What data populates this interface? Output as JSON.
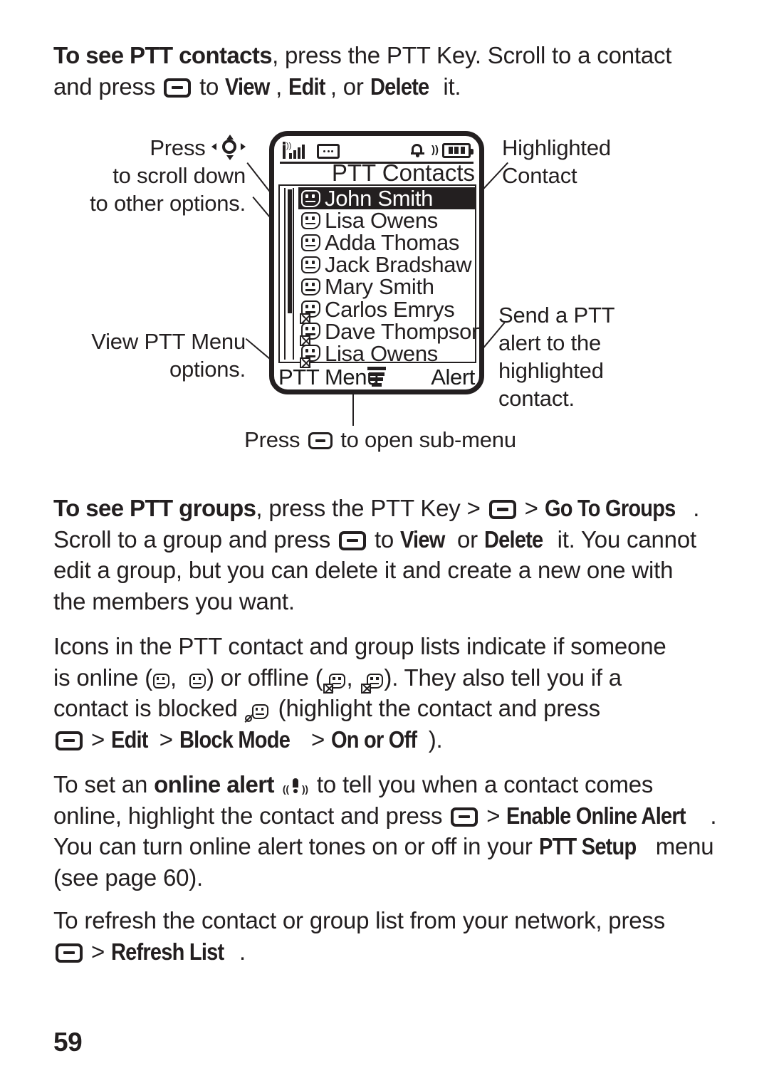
{
  "document": {
    "page_number": "59"
  },
  "sections": {
    "ptt_contacts": {
      "lead_bold": "To see PTT contacts",
      "text_1": ", press the PTT Key. Scroll to a contact",
      "text_2a": "and press",
      "text_2b": "to",
      "view_label": "View",
      "comma_1": ",",
      "edit_label": "Edit",
      "or_label": ", or",
      "delete_label": "Delete",
      "text_2c": "it."
    },
    "ptt_groups": {
      "lead_bold": "To see PTT groups",
      "text_1": ", press the PTT Key >",
      "gt": ">",
      "go_to_groups": "Go To Groups",
      "period": ".",
      "line2_a": "Scroll to a group and press",
      "line2_b": "to",
      "view_label": "View",
      "line2_c": "or",
      "delete_label": "Delete",
      "line2_d": "it. You cannot",
      "line3": "edit a group, but you can delete it and create a new one with",
      "line4": "the members you want."
    },
    "icons_paragraph": {
      "line1": "Icons in the PTT contact and group lists indicate if someone",
      "line2_a": "is online (",
      "line2_comma": ",",
      "line2_b": ") or offline (",
      "line2_c": ").  They also tell you if a",
      "line3_a": "contact is blocked",
      "line3_b": "(highlight the contact and press",
      "line4_gt1": ">",
      "edit_label": "Edit",
      "line4_gt2": ">",
      "block_mode_label": "Block Mode",
      "line4_gt3": ">",
      "on_or_off_label": "On or Off",
      "line4_end": ")."
    },
    "online_alert": {
      "line1_a": "To set an",
      "online_alert_bold": "online alert",
      "line1_b": "to tell you when a contact comes",
      "line2_a": "online, highlight the contact and press",
      "line2_gt": ">",
      "enable_online_alert": "Enable Online Alert",
      "line2_end": ".",
      "line3_a": "You can turn online alert tones on or off in your",
      "ptt_setup_label": "PTT Setup",
      "line3_b": "menu",
      "line4": "(see page 60)."
    },
    "refresh": {
      "line1": "To refresh the contact or group list from your network, press",
      "gt": ">",
      "refresh_list_label": "Refresh List",
      "period": "."
    }
  },
  "diagram": {
    "annotations": {
      "scroll_down": {
        "press_word": "Press",
        "line2": "to scroll down",
        "line3": "to other options."
      },
      "highlighted_contact": {
        "line1": "Highlighted",
        "line2": "Contact"
      },
      "send_alert": {
        "line1": "Send a PTT",
        "line2": "alert to the",
        "line3": "highlighted",
        "line4": "contact."
      },
      "view_menu": {
        "line1": "View PTT Menu",
        "line2": "options."
      },
      "sub_menu_caption": {
        "before": "Press",
        "after": "to open sub-menu"
      }
    },
    "phone": {
      "status_bar": {
        "signal_icon": "signal-bars-icon",
        "message_icon": "message-icon",
        "alert_icon": "bell-alert-icon",
        "battery_icon": "battery-icon"
      },
      "screen_title": "PTT Contacts",
      "contacts": [
        {
          "name": "John Smith",
          "selected": true,
          "offline": false
        },
        {
          "name": "Lisa Owens",
          "selected": false,
          "offline": false
        },
        {
          "name": "Adda Thomas",
          "selected": false,
          "offline": false
        },
        {
          "name": "Jack Bradshaw",
          "selected": false,
          "offline": false
        },
        {
          "name": "Mary Smith",
          "selected": false,
          "offline": false
        },
        {
          "name": "Carlos Emrys",
          "selected": false,
          "offline": true
        },
        {
          "name": "Dave Thompson",
          "selected": false,
          "offline": true
        },
        {
          "name": "Lisa Owens",
          "selected": false,
          "offline": true
        }
      ],
      "softkeys": {
        "left": "PTT Menu",
        "center_icon": "menu-icon",
        "right": "Alert"
      },
      "scrollbar_thumb_percent": 72
    }
  }
}
